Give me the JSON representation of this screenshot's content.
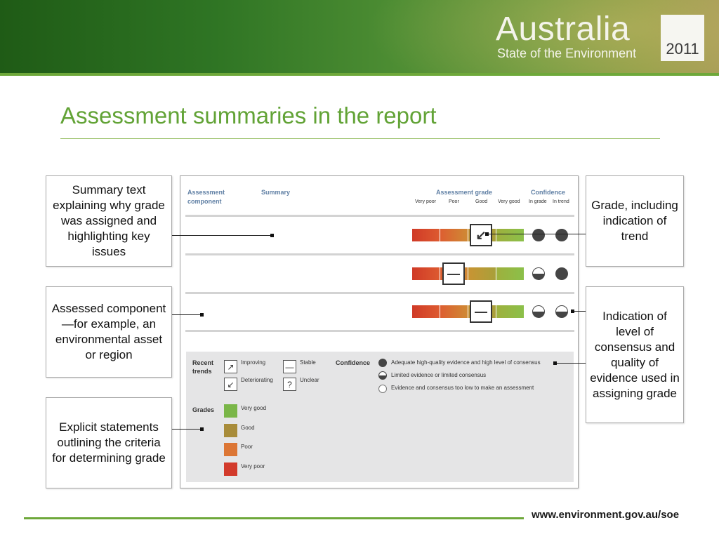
{
  "header": {
    "brand_name": "Australia",
    "brand_subtitle": "State of the Environment",
    "brand_year": "2011"
  },
  "title": "Assessment summaries in the report",
  "callouts": {
    "summary_text": "Summary text explaining why grade was assigned and highlighting key issues",
    "assessed_component": "Assessed component—for example, an environmental asset or region",
    "explicit_statements": "Explicit statements outlining the criteria for determining grade",
    "grade_trend": "Grade, including indication of trend",
    "consensus": "Indication of level of consensus and quality of evidence used in assigning grade"
  },
  "panel": {
    "col_component": "Assessment component",
    "col_summary": "Summary",
    "col_grade": "Assessment grade",
    "col_confidence": "Confidence",
    "grade_levels": [
      "Very poor",
      "Poor",
      "Good",
      "Very good"
    ],
    "confidence_levels": [
      "In grade",
      "In trend"
    ],
    "rows": [
      {
        "grade_position": "good",
        "trend": "deteriorating",
        "trend_symbol": "↙",
        "confidence_in_grade": "adequate",
        "confidence_in_trend": "adequate"
      },
      {
        "grade_position": "poor",
        "trend": "stable",
        "trend_symbol": "—",
        "confidence_in_grade": "limited",
        "confidence_in_trend": "adequate"
      },
      {
        "grade_position": "good",
        "trend": "stable",
        "trend_symbol": "—",
        "confidence_in_grade": "limited",
        "confidence_in_trend": "limited"
      }
    ],
    "legend": {
      "recent_trends_label": "Recent trends",
      "trends": [
        {
          "symbol": "↗",
          "label": "Improving"
        },
        {
          "symbol": "—",
          "label": "Stable"
        },
        {
          "symbol": "↙",
          "label": "Deteriorating"
        },
        {
          "symbol": "?",
          "label": "Unclear"
        }
      ],
      "confidence_label": "Confidence",
      "confidence_items": [
        {
          "type": "full",
          "label": "Adequate high-quality evidence and high level of consensus"
        },
        {
          "type": "half",
          "label": "Limited evidence or limited consensus"
        },
        {
          "type": "empty",
          "label": "Evidence and consensus too low to make an assessment"
        }
      ],
      "grades_label": "Grades",
      "grades": [
        {
          "label": "Very good",
          "color": "#7ab648"
        },
        {
          "label": "Good",
          "color": "#a88c3a"
        },
        {
          "label": "Poor",
          "color": "#dc7635"
        },
        {
          "label": "Very poor",
          "color": "#d23a2b"
        }
      ]
    }
  },
  "colors": {
    "title_green": "#62a336",
    "header_blue": "#5f7fa4",
    "very_poor": "#d23a2b",
    "poor": "#dc7635",
    "good": "#a88c3a",
    "very_good": "#7ab648"
  },
  "footer": {
    "url": "www.environment.gov.au/soe"
  }
}
